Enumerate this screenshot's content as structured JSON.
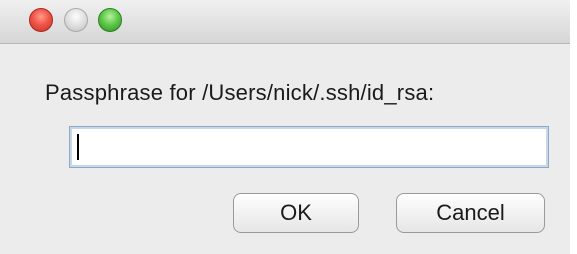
{
  "dialog": {
    "prompt": "Passphrase for /Users/nick/.ssh/id_rsa:",
    "passphrase_value": "",
    "ok_label": "OK",
    "cancel_label": "Cancel"
  },
  "icons": {
    "close": "close-window-icon",
    "minimize": "minimize-window-icon",
    "zoom": "zoom-window-icon"
  },
  "colors": {
    "close": "#f0564a",
    "minimize": "#dcdcdc",
    "zoom": "#5fc94a",
    "field_border": "#8fa7c4"
  }
}
